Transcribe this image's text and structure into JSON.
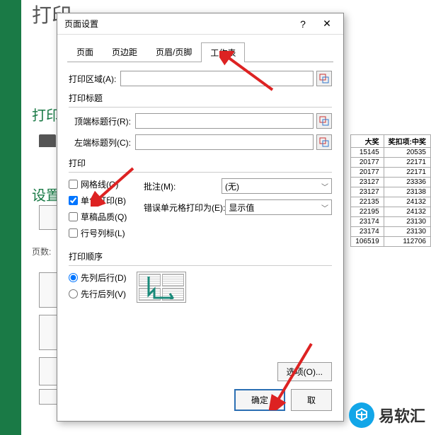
{
  "background": {
    "title": "打印",
    "section1": "打印",
    "section2": "设置",
    "pages_label": "页数:"
  },
  "dialog": {
    "title": "页面设置",
    "help": "?",
    "close": "✕",
    "tabs": [
      "页面",
      "页边距",
      "页眉/页脚",
      "工作表"
    ],
    "active_tab": 3,
    "print_area_label": "打印区域(A):",
    "print_titles_label": "打印标题",
    "top_row_label": "顶端标题行(R):",
    "left_col_label": "左端标题列(C):",
    "print_section_label": "打印",
    "checks": {
      "gridlines": "网格线(G)",
      "mono": "单色打印(B)",
      "draft": "草稿品质(Q)",
      "rowcol": "行号列标(L)"
    },
    "selects": {
      "comments_label": "批注(M):",
      "comments_value": "(无)",
      "errors_label": "错误单元格打印为(E):",
      "errors_value": "显示值"
    },
    "order_label": "打印顺序",
    "radios": {
      "down_then_over": "先列后行(D)",
      "over_then_down": "先行后列(V)"
    },
    "options_btn": "选项(O)...",
    "ok_btn": "确定",
    "cancel_btn": "取"
  },
  "table": {
    "headers": [
      "大奖",
      "奖扣项:中奖"
    ],
    "rows": [
      [
        "15145",
        "20535"
      ],
      [
        "20177",
        "22171"
      ],
      [
        "20177",
        "22171"
      ],
      [
        "23127",
        "23336"
      ],
      [
        "23127",
        "23138"
      ],
      [
        "22135",
        "24132"
      ],
      [
        "22195",
        "24132"
      ],
      [
        "23174",
        "23130"
      ],
      [
        "23174",
        "23130"
      ],
      [
        "106519",
        "112706"
      ]
    ]
  },
  "watermark": "易软汇"
}
